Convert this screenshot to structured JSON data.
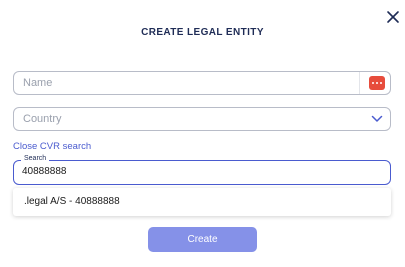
{
  "dialog": {
    "title": "CREATE LEGAL ENTITY",
    "close_icon": "close-icon"
  },
  "form": {
    "name": {
      "placeholder": "Name",
      "value": "",
      "badge_icon": "more-dots-icon"
    },
    "country": {
      "placeholder": "Country",
      "value": "",
      "icon": "chevron-down-icon"
    },
    "cvr_link_label": "Close CVR search",
    "search": {
      "label": "Search",
      "value": "40888888"
    },
    "results": [
      {
        "label": ".legal A/S - 40888888"
      }
    ],
    "create_label": "Create"
  },
  "colors": {
    "title": "#1f2c56",
    "accent": "#4a5bcf",
    "button": "#8591e8",
    "badge": "#e74c3c",
    "border": "#b8bcc8"
  }
}
